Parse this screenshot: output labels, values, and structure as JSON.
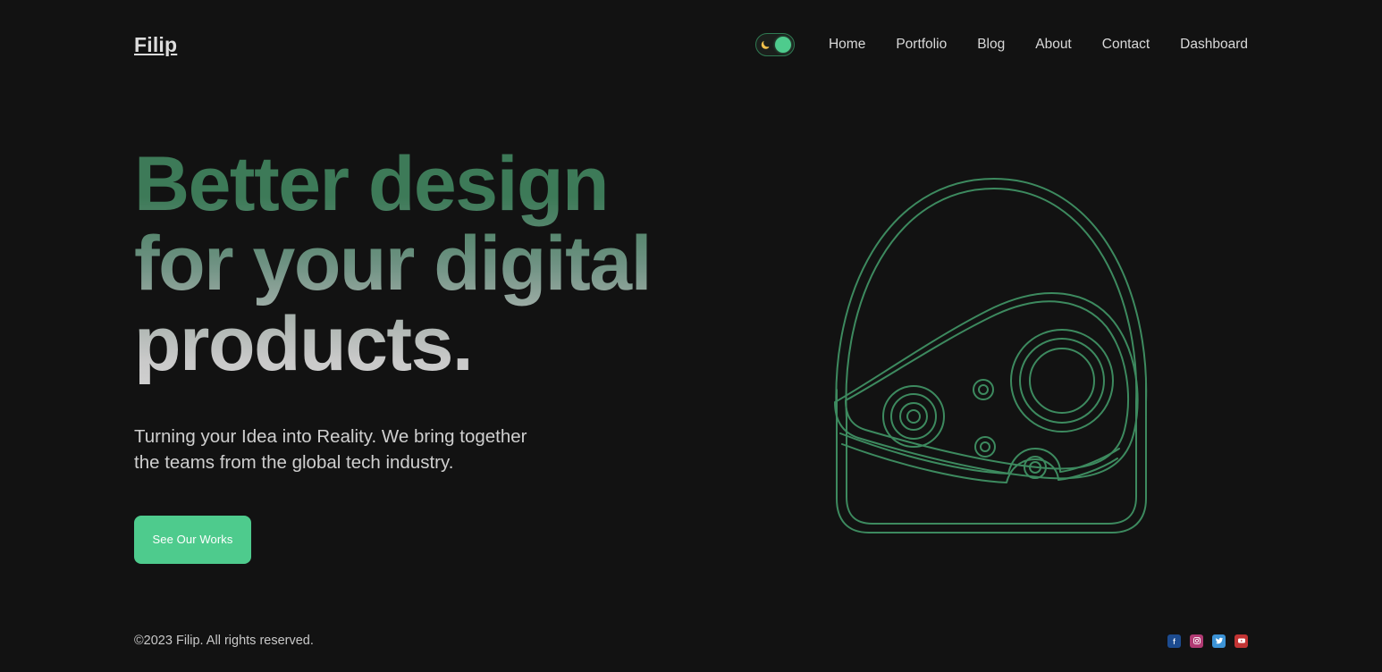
{
  "site": {
    "background_color": "#121212",
    "accent_color": "#4ecb8d",
    "art_line_color": "#3d8a5f",
    "brand": "Filip"
  },
  "header": {
    "theme_toggle": {
      "name": "dark-mode-toggle",
      "state": "dark",
      "moon_icon": "moon-icon",
      "knob_color": "#4ecb8d",
      "border_color": "#2f7a52"
    },
    "nav": [
      {
        "label": "Home",
        "name": "nav-link-home"
      },
      {
        "label": "Portfolio",
        "name": "nav-link-portfolio"
      },
      {
        "label": "Blog",
        "name": "nav-link-blog"
      },
      {
        "label": "About",
        "name": "nav-link-about"
      },
      {
        "label": "Contact",
        "name": "nav-link-contact"
      },
      {
        "label": "Dashboard",
        "name": "nav-link-dashboard"
      }
    ]
  },
  "hero": {
    "title": "Better design\nfor your digital\nproducts.",
    "subtitle": "Turning your Idea into Reality. We bring together\nthe teams from the global tech industry.",
    "cta_label": "See Our Works",
    "illustration": "helmet-line-art"
  },
  "footer": {
    "copyright": "©2023 Filip. All rights reserved.",
    "social": [
      {
        "label": "Facebook",
        "name": "facebook-icon",
        "color": "#1c4b8f"
      },
      {
        "label": "Instagram",
        "name": "instagram-icon",
        "color": "#b13a73"
      },
      {
        "label": "Twitter",
        "name": "twitter-icon",
        "color": "#3c93d6"
      },
      {
        "label": "YouTube",
        "name": "youtube-icon",
        "color": "#c23434"
      }
    ]
  }
}
